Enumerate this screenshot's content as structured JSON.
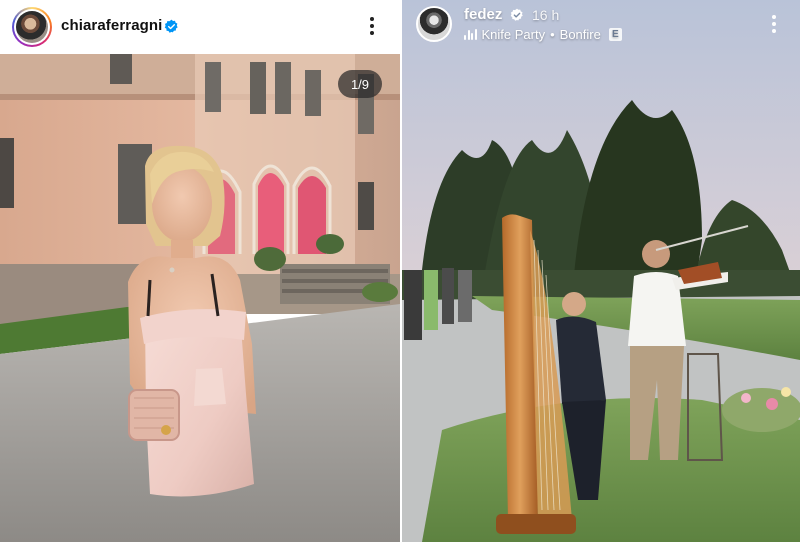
{
  "post": {
    "username": "chiaraferragni",
    "verified_icon": "verified-badge-icon",
    "more_icon": "more-options-icon",
    "carousel_counter": "1/9",
    "avatar_icon": "profile-avatar"
  },
  "story": {
    "username": "fedez",
    "time_ago": "16 h",
    "music": {
      "artist": "Knife Party",
      "separator": "•",
      "track": "Bonfire",
      "explicit": "E"
    },
    "verified_icon": "verified-badge-icon",
    "more_icon": "more-options-icon",
    "audio_icon": "audio-waveform-icon"
  },
  "colors": {
    "verified_blue": "#0095f6",
    "story_text": "#ffffff"
  }
}
